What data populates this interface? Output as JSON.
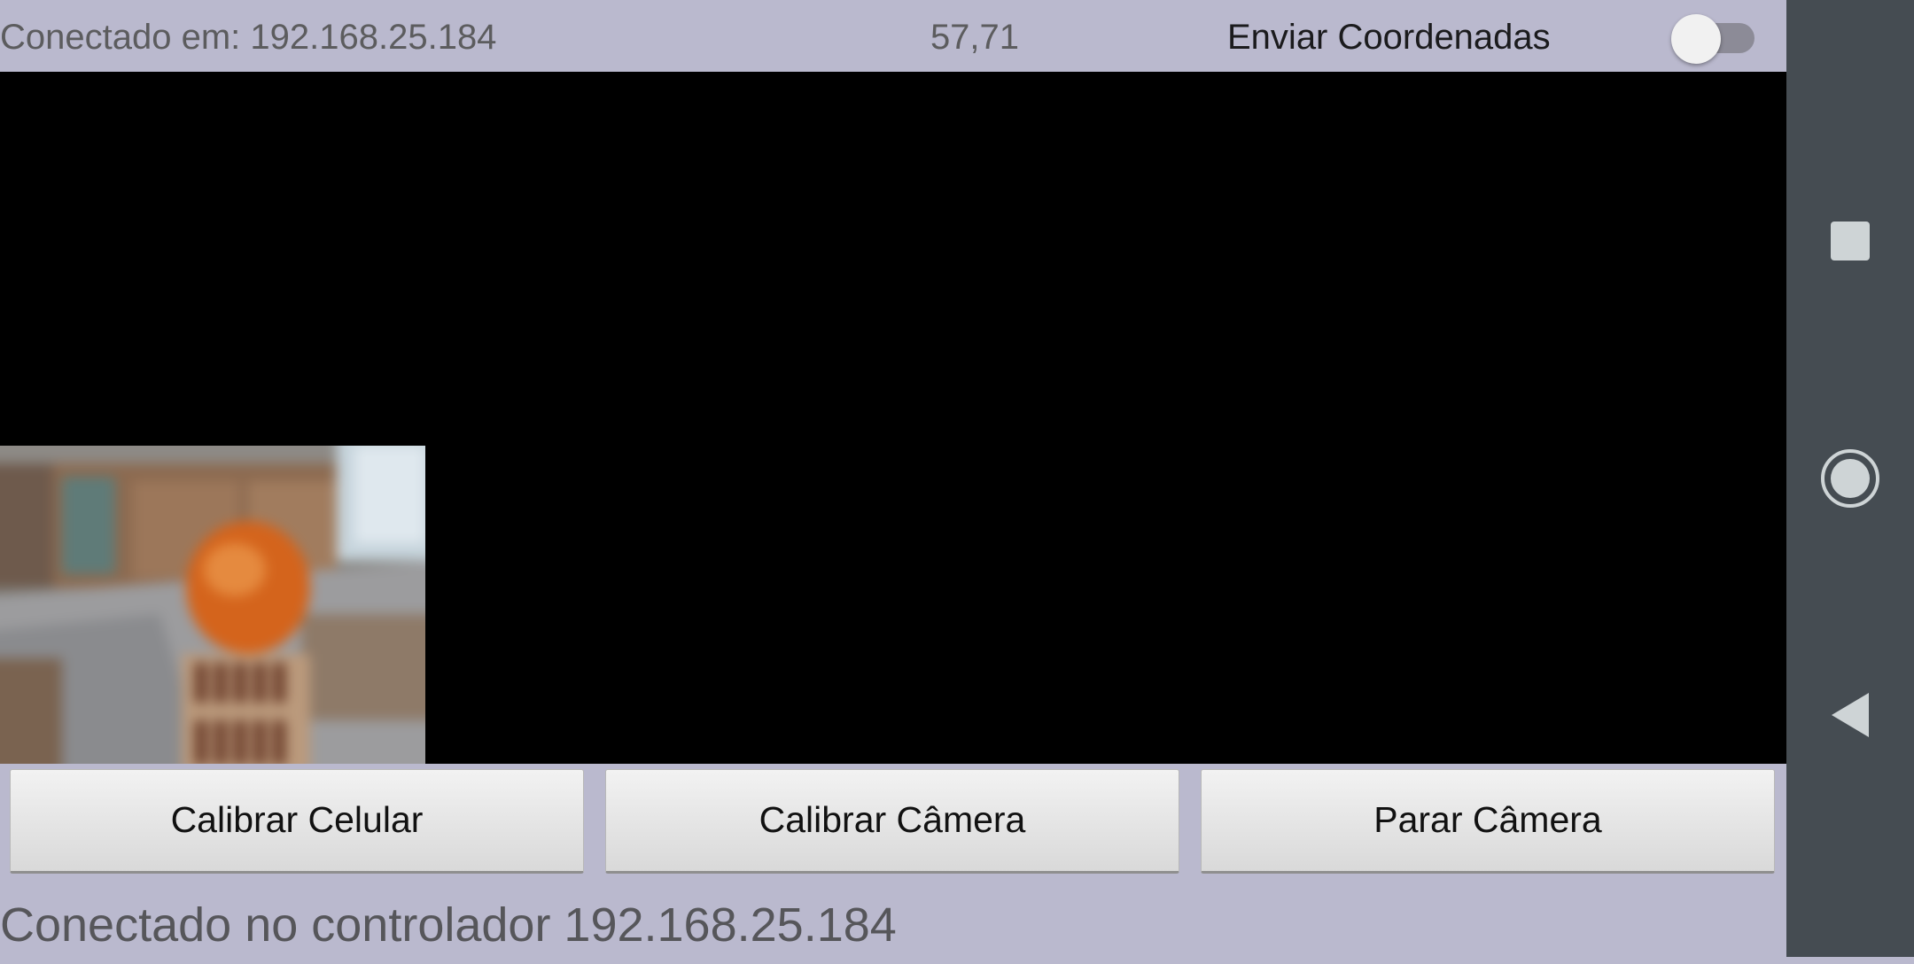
{
  "topbar": {
    "connection_text": "Conectado em: 192.168.25.184",
    "coordinates": "57,71",
    "send_coordinates_label": "Enviar Coordenadas",
    "send_coordinates_enabled": false
  },
  "camera": {
    "thumbnail_subject": "orange-on-brick-camera-frame"
  },
  "buttons": {
    "calibrate_phone": "Calibrar Celular",
    "calibrate_camera": "Calibrar Câmera",
    "stop_camera": "Parar Câmera"
  },
  "status": {
    "bottom_text": "Conectado no controlador 192.168.25.184"
  },
  "navigation": {
    "icons": [
      "recents-icon",
      "home-icon",
      "back-icon"
    ]
  },
  "colors": {
    "background": "#bab9ce",
    "preview": "#000000",
    "navbar": "#454c52"
  }
}
